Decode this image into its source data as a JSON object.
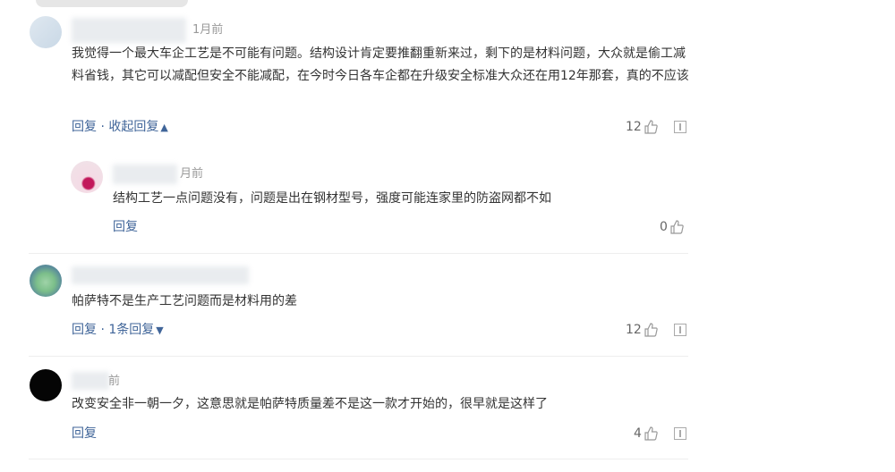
{
  "comments": [
    {
      "time": "1月前",
      "text": "我觉得一个最大车企工艺是不可能有问题。结构设计肯定要推翻重新来过，剩下的是材料问题，大众就是偷工减料省钱，其它可以减配但安全不能减配，在今时今日各车企都在升级安全标准大众还在用12年那套，真的不应该",
      "reply_label": "回复",
      "toggle_label": "收起回复",
      "likes": "12",
      "replies": [
        {
          "time": "月前",
          "text": "结构工艺一点问题没有，问题是出在钢材型号，强度可能连家里的防盗网都不如",
          "reply_label": "回复",
          "likes": "0"
        }
      ]
    },
    {
      "time": "",
      "text": "帕萨特不是生产工艺问题而是材料用的差",
      "reply_label": "回复",
      "toggle_label": "1条回复",
      "likes": "12"
    },
    {
      "time": "前",
      "text": "改变安全非一朝一夕，这意思就是帕萨特质量差不是这一款才开始的，很早就是这样了",
      "reply_label": "回复",
      "likes": "4"
    }
  ],
  "separator": "·",
  "icons": {
    "like": "thumbs-up-icon",
    "report": "report-icon",
    "chevron_up": "chevron-up-icon",
    "chevron_down": "chevron-down-icon"
  },
  "colors": {
    "link": "#406599",
    "text": "#333333",
    "muted": "#999999"
  }
}
